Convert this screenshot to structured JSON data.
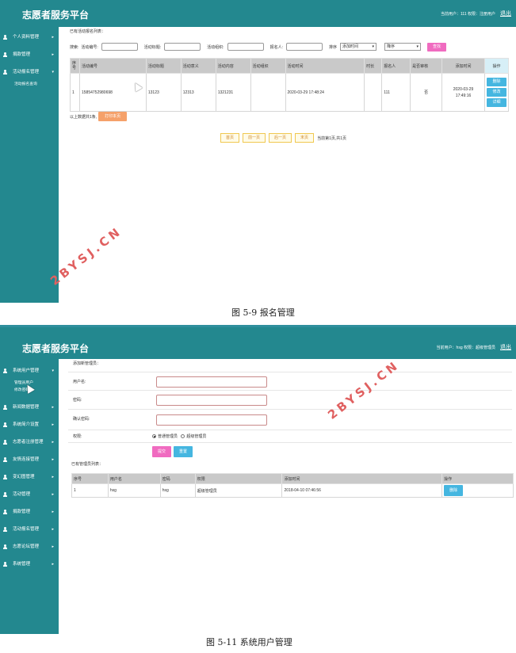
{
  "shot1": {
    "app_title": "志愿者服务平台",
    "user_info": "当前用户：111 权限：注册用户",
    "logout": "退出",
    "sidebar": {
      "items": [
        {
          "label": "个人资料管理"
        },
        {
          "label": "捐款管理"
        },
        {
          "label": "活动报名管理"
        }
      ],
      "sub_item": "活动报名查询"
    },
    "list_title": "已有活动报名列表：",
    "search": {
      "label": "搜索:",
      "activity_no_label": "活动编号:",
      "activity_title_label": "活动标题:",
      "activity_org_label": "活动组织:",
      "applicant_label": "报名人:",
      "sort_label": "排序",
      "sort_field_value": "添加时间",
      "sort_order_value": "降序",
      "search_button": "查找"
    },
    "table": {
      "headers": [
        "序号",
        "活动编号",
        "活动标题",
        "活动意义",
        "活动内容",
        "活动组织",
        "活动时间",
        "时长",
        "报名人",
        "是否审核",
        "添加时间",
        "操作"
      ],
      "rows": [
        {
          "index": "1",
          "activity_no": "15854752980698",
          "title": "13123",
          "meaning": "12313",
          "content": "1321231",
          "org": "",
          "time": "2020-03-29 17:48:24",
          "duration": "",
          "applicant": "111",
          "reviewed": "否",
          "added_date": "2020-03-29",
          "added_time": "17:49:16"
        }
      ],
      "actions": {
        "delete": "删除",
        "edit": "修改",
        "detail": "详细"
      }
    },
    "summary_text": "以上数据共1条,",
    "print_button": "打印本页",
    "pager": {
      "first": "首页",
      "prev": "前一页",
      "next": "后一页",
      "last": "末页",
      "status": "当前第1页,共1页"
    },
    "watermark": "2BYSJ.CN",
    "caption": "图 5-9 报名管理"
  },
  "shot2": {
    "app_title": "志愿者服务平台",
    "user_info": "当前用户：hsg 权限：超级管理员",
    "logout": "退出",
    "sidebar": {
      "first_item": "系统用户管理",
      "sub_items": [
        "管理员用户",
        "修改密码"
      ],
      "items": [
        {
          "label": "新闻数据管理"
        },
        {
          "label": "系统简介设置"
        },
        {
          "label": "志愿者注册管理"
        },
        {
          "label": "友情连接管理"
        },
        {
          "label": "变幻图管理"
        },
        {
          "label": "活动管理"
        },
        {
          "label": "捐款管理"
        },
        {
          "label": "活动报名管理"
        },
        {
          "label": "志愿论坛管理"
        },
        {
          "label": "系统管理"
        }
      ]
    },
    "form_title": "添加新管理员：",
    "form": {
      "username_label": "用户名:",
      "password_label": "密码:",
      "confirm_label": "确认密码:",
      "permission_label": "权限:",
      "perm_normal": "普通管理员",
      "perm_super": "超级管理员",
      "submit_button": "提交",
      "reset_button": "重置"
    },
    "list_title": "已有管理员列表：",
    "table": {
      "headers": [
        "序号",
        "用户名",
        "密码",
        "权限",
        "添加时间",
        "操作"
      ],
      "rows": [
        {
          "index": "1",
          "username": "hsg",
          "password": "hsg",
          "permission": "超级管理员",
          "added_time": "2018-04-10 07:46:56"
        }
      ],
      "delete_button": "删除"
    },
    "watermark": "2BYSJ.CN",
    "caption": "图 5-11 系统用户管理"
  },
  "colors": {
    "primary": "#23888f",
    "pink_button": "#f06bc0",
    "blue_button": "#45b6e0",
    "orange_button": "#f5a16a",
    "watermark": "#e06060"
  }
}
